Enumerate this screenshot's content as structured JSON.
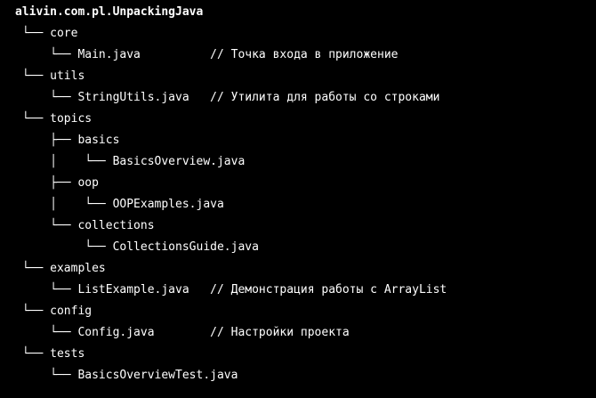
{
  "tree": {
    "lines": [
      "alivin.com.pl.UnpackingJava",
      " └── core",
      "     └── Main.java          // Точка входа в приложение",
      " └── utils",
      "     └── StringUtils.java   // Утилита для работы со строками",
      " └── topics",
      "     ├── basics",
      "     │    └── BasicsOverview.java",
      "     ├── oop",
      "     │    └── OOPExamples.java",
      "     └── collections",
      "          └── CollectionsGuide.java",
      " └── examples",
      "     └── ListExample.java   // Демонстрация работы с ArrayList",
      " └── config",
      "     └── Config.java        // Настройки проекта",
      " └── tests",
      "     └── BasicsOverviewTest.java"
    ]
  }
}
